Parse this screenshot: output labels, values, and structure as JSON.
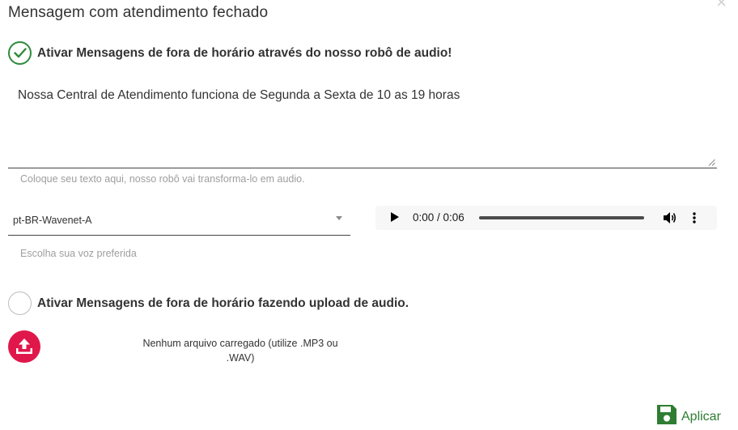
{
  "dialog": {
    "title": "Mensagem com atendimento fechado",
    "close_label": "×"
  },
  "tts_option": {
    "label": "Ativar Mensagens de fora de horário através do nosso robô de audio!",
    "selected": true
  },
  "message": {
    "value": "Nossa Central de Atendimento funciona de Segunda a Sexta de 10 as 19 horas",
    "helper": "Coloque seu texto aqui, nosso robô vai transforma-lo em audio."
  },
  "voice": {
    "selected": "pt-BR-Wavenet-A",
    "helper": "Escolha sua voz preferida"
  },
  "audio_player": {
    "time": "0:00 / 0:06",
    "progress": 0
  },
  "upload_option": {
    "label": "Ativar Mensagens de fora de horário fazendo upload de audio.",
    "selected": false
  },
  "upload": {
    "status": "Nenhum arquivo carregado (utilize .MP3 ou .WAV)"
  },
  "actions": {
    "apply_label": "Aplicar"
  },
  "colors": {
    "success": "#2e8b3c",
    "upload_accent": "#e0174a",
    "apply": "#2e7d32"
  }
}
